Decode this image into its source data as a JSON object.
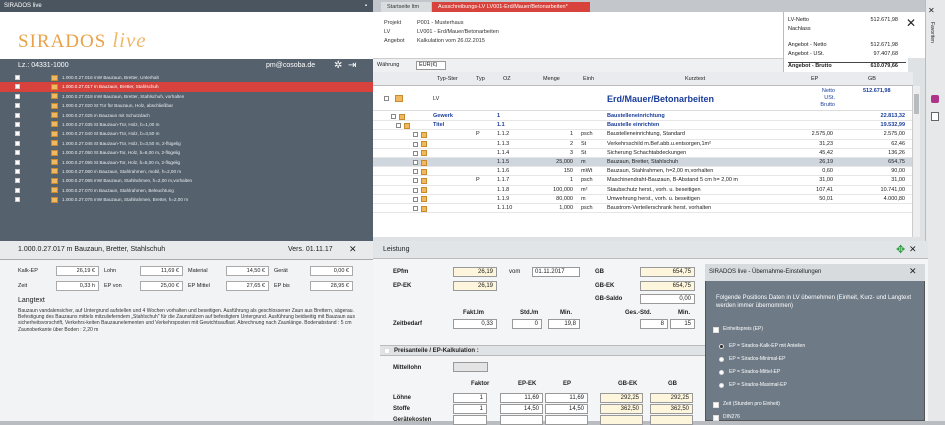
{
  "left": {
    "title": "SIRADOS live",
    "logo": {
      "brand": "SIRADOS",
      "live": "live"
    },
    "login": {
      "lz": "Lz.: 04331-1000",
      "email": "pm@cosoba.de"
    },
    "tree": [
      "1.000.0.27.016 mW Bauzaun, Bretter, Unterhalt",
      "1.000.0.27.017 m Bauzaun, Bretter, Stahlschuh",
      "1.000.0.27.018 mW Bauzaun, Bretter, Stahlschuh, vorhalten",
      "1.000.0.27.020 St Tür für Bauzaun, Holz, abschließbar",
      "1.000.0.27.025 m Bauzaun mit Schutzdach",
      "1.000.0.27.035 St Bauzaun-Tür, Holz, b=1,00 m",
      "1.000.0.27.040 St Bauzaun-Tür, Holz, b=3,50 m",
      "1.000.0.27.045 St Bauzaun-Tür, Holz, b=3,50 m, 2-flügelig",
      "1.000.0.27.050 St Bauzaun-Tor, Holz, b=6,00 m, 2-flügelig",
      "1.000.0.27.055 St Bauzaun-Tor, Holz, b=5,00 m, 2-flügelig",
      "1.000.0.27.060 m Bauzaun, Stahlrahmen, mobil, h=2,00 m",
      "1.000.0.27.065 mW Bauzaun, Stahlrahmen, h=2,00 m,vorhalten",
      "1.000.0.27.070 m Bauzaun, Stahlrahmen, Beleuchtung",
      "1.000.0.27.075 mW Bauzaun, Stahlrahmen, Bretter, h=2,00 m"
    ],
    "detail": {
      "title": "1.000.0.27.017 m Bauzaun, Bretter, Stahlschuh",
      "version": "Vers. 01.11.17",
      "fields": {
        "kalk_ep_label": "Kalk-EP",
        "kalk_ep": "26,19 €",
        "lohn_label": "Lohn",
        "lohn": "11,69 €",
        "material_label": "Material",
        "material": "14,50 €",
        "geraet_label": "Gerät",
        "geraet": "0,00 €",
        "zeit_label": "Zeit",
        "zeit": "0,33 h",
        "ep_von_label": "EP von",
        "ep_von": "25,00 €",
        "ep_mittel_label": "EP Mittel",
        "ep_mittel": "27,65 €",
        "ep_bis_label": "EP bis",
        "ep_bis": "28,95 €"
      },
      "langtext_label": "Langtext",
      "langtext": "Bauzaun vandalensicher, auf Untergrund aufstellen und 4 Wochen vorhalten und beseitigen. Ausführung als geschlossener Zaun aus Brettern, sägerau. Befestigung des Bauzauns mittels mitzulieferndem „Stahlschuh\" für die Zaunstützen auf befestigtem Untergrund. Ausführung beidseitig mit Bauzaun aus sicherheitsvorschrift, Verkehrs-keiten Bauzaunelementen und Verkehrsposten mit Gewichtsauflast. Abrechnung nach Zaunlänge. Bodenabstand : 5 cm  Zaunoberkante über Boden : 2,20 m"
    }
  },
  "right": {
    "tab1": "Startseite ltm",
    "tab2": "Ausschreibungs-LV LV001-Erd/Mauer/Betonarbeiten*",
    "project": {
      "projekt_label": "Projekt",
      "projekt": "P001 - Musterhaus",
      "lv_label": "LV",
      "lv": "LV001 - Erd/Mauer/Betonarbeiten",
      "angebot_label": "Angebot",
      "angebot": "Kalkulation vom 26.02.2015"
    },
    "summary": [
      {
        "label": "LV-Netto",
        "value": "512.671,98"
      },
      {
        "label": "Nachlass",
        "value": ""
      },
      {
        "label": "Angebot - Netto",
        "value": "512.671,98"
      },
      {
        "label": "Angebot - USt.",
        "value": "97.407,68"
      },
      {
        "label": "Angebot - Brutto",
        "value": "610.079,66"
      }
    ],
    "currency_label": "Währung",
    "currency": "EUR(€)",
    "columns": [
      "Typ-Ster",
      "Typ",
      "OZ",
      "Menge",
      "Einh",
      "Kurztext",
      "EP",
      "GB"
    ],
    "lv_row": {
      "typ": "LV",
      "kurztext": "Erd/Mauer/Betonarbeiten",
      "ep1": "Netto",
      "ep2": "USt.",
      "ep3": "Brutto",
      "gb": "512.671,98"
    },
    "rows": [
      {
        "typ": "Gewerk",
        "t": "",
        "oz": "1",
        "menge": "",
        "einh": "",
        "text": "Baustelleneinrichtung",
        "ep": "",
        "gb": "22.813,32",
        "bold": true
      },
      {
        "typ": "Titel",
        "t": "",
        "oz": "1.1",
        "menge": "",
        "einh": "",
        "text": "Baustelle einrichten",
        "ep": "",
        "gb": "19.532,99",
        "bold": true
      },
      {
        "typ": "",
        "t": "P",
        "oz": "1.1.2",
        "menge": "1",
        "einh": "psch",
        "text": "Baustelleneinrichtung, Standard",
        "ep": "2.575,00",
        "gb": "2.575,00"
      },
      {
        "typ": "",
        "t": "",
        "oz": "1.1.3",
        "menge": "2",
        "einh": "St",
        "text": "Verkehrsschild m.Bef.abb.u.entsorgen,1m²",
        "ep": "31,23",
        "gb": "62,46"
      },
      {
        "typ": "",
        "t": "",
        "oz": "1.1.4",
        "menge": "3",
        "einh": "St",
        "text": "Sicherung Schachtabdeckungen",
        "ep": "45,42",
        "gb": "136,26"
      },
      {
        "typ": "",
        "t": "",
        "oz": "1.1.5",
        "menge": "25,000",
        "einh": "m",
        "text": "Bauzaun, Bretter, Stahlschuh",
        "ep": "26,19",
        "gb": "654,75",
        "sel": true
      },
      {
        "typ": "",
        "t": "",
        "oz": "1.1.6",
        "menge": "150",
        "einh": "mWt",
        "text": "Bauzaun, Stahlrahmen, h=2,00 m,vorhalten",
        "ep": "0,60",
        "gb": "90,00"
      },
      {
        "typ": "",
        "t": "P",
        "oz": "1.1.7",
        "menge": "1",
        "einh": "psch",
        "text": "Maschinendraht-Bauzaun, B-Abstand 5 cm h= 2,00 m",
        "ep": "31,00",
        "gb": "31,00"
      },
      {
        "typ": "",
        "t": "",
        "oz": "1.1.8",
        "menge": "100,000",
        "einh": "m²",
        "text": "Staubschutz herst., vorh. u. beseitigen",
        "ep": "107,41",
        "gb": "10.741,00"
      },
      {
        "typ": "",
        "t": "",
        "oz": "1.1.9",
        "menge": "80,000",
        "einh": "m",
        "text": "Umwehrung herst., vorh. u. beseitigen",
        "ep": "50,01",
        "gb": "4.000,80"
      },
      {
        "typ": "",
        "t": "",
        "oz": "1.1.10",
        "menge": "1,000",
        "einh": "psch",
        "text": "Baustrom-Verteilerschrank herst. vorhalten",
        "ep": "",
        "gb": ""
      }
    ],
    "leistung": {
      "title": "Leistung",
      "epfm_label": "EPfm",
      "epfm": "26,19",
      "vom_label": "vom",
      "vom": "01.11.2017",
      "gb_label": "GB",
      "gb": "654,75",
      "ep_ek_label": "EP-EK",
      "ep_ek": "26,19",
      "gb_ek_label": "GB-EK",
      "gb_ek": "654,75",
      "gb_saldo_label": "GB-Saldo",
      "gb_saldo": "0,00",
      "zeitbedarf_label": "Zeitbedarf",
      "h_fakt": "Fakt.lm",
      "h_std": "Std./m",
      "h_min": "Min.",
      "h_gesstd": "Ges.-Std.",
      "h_min2": "Min.",
      "z_fakt": "0,33",
      "z_std": "0",
      "z_min": "19,8",
      "z_ges": "8",
      "z_min2": "15",
      "preis_label": "Preisanteile / EP-Kalkulation :",
      "mittellohn_label": "Mittellohn",
      "cols": [
        "Faktor",
        "EP-EK",
        "EP",
        "GB-EK",
        "GB"
      ],
      "lines": [
        {
          "label": "Löhne",
          "faktor": "1",
          "ep_ek": "11,69",
          "ep": "11,69",
          "gb_ek": "292,25",
          "gb": "292,25"
        },
        {
          "label": "Stoffe",
          "faktor": "1",
          "ep_ek": "14,50",
          "ep": "14,50",
          "gb_ek": "362,50",
          "gb": "362,50"
        },
        {
          "label": "Gerätekosten",
          "faktor": "",
          "ep_ek": "",
          "ep": "",
          "gb_ek": "",
          "gb": ""
        }
      ]
    },
    "popup": {
      "title": "SIRADOS live - Übernahme-Einstellungen",
      "intro": "Folgende Positions Daten in LV übernehmen (Einheit, Kurz- und Langtext werden immer übernommen)",
      "einheitspreis": "Einheitspreis (EP)",
      "options": [
        "EP = Sirados-Kalk-EP mit Anteilen",
        "EP = Sirados-Minimal-EP",
        "EP = Sirados-Mittel-EP",
        "EP = Sirados-Maximal-EP"
      ],
      "zeit": "Zeit (Stunden pro Einheit)",
      "din": "DIN276"
    },
    "favorites": "Favoriten"
  }
}
